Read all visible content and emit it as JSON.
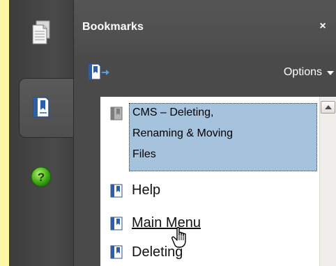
{
  "panel": {
    "title": "Bookmarks",
    "close_label": "×",
    "options_label": "Options"
  },
  "strip": {
    "tabs": [
      {
        "icon": "pages-icon",
        "active": false
      },
      {
        "icon": "bookmarks-icon",
        "active": true
      },
      {
        "icon": "help-icon",
        "active": false
      }
    ],
    "help_glyph": "?"
  },
  "bookmarks": {
    "selected": {
      "lines": [
        "CMS – Deleting,",
        "Renaming & Moving",
        "Files"
      ]
    },
    "items": [
      {
        "label": "Help"
      },
      {
        "label": "Main Menu"
      },
      {
        "label": "Deleting"
      }
    ]
  },
  "colors": {
    "background": "#fdf8a6",
    "panel": "#4a4a4a",
    "selection": "#a6c3dd",
    "bookmark_icon": "#2d5fa8"
  }
}
